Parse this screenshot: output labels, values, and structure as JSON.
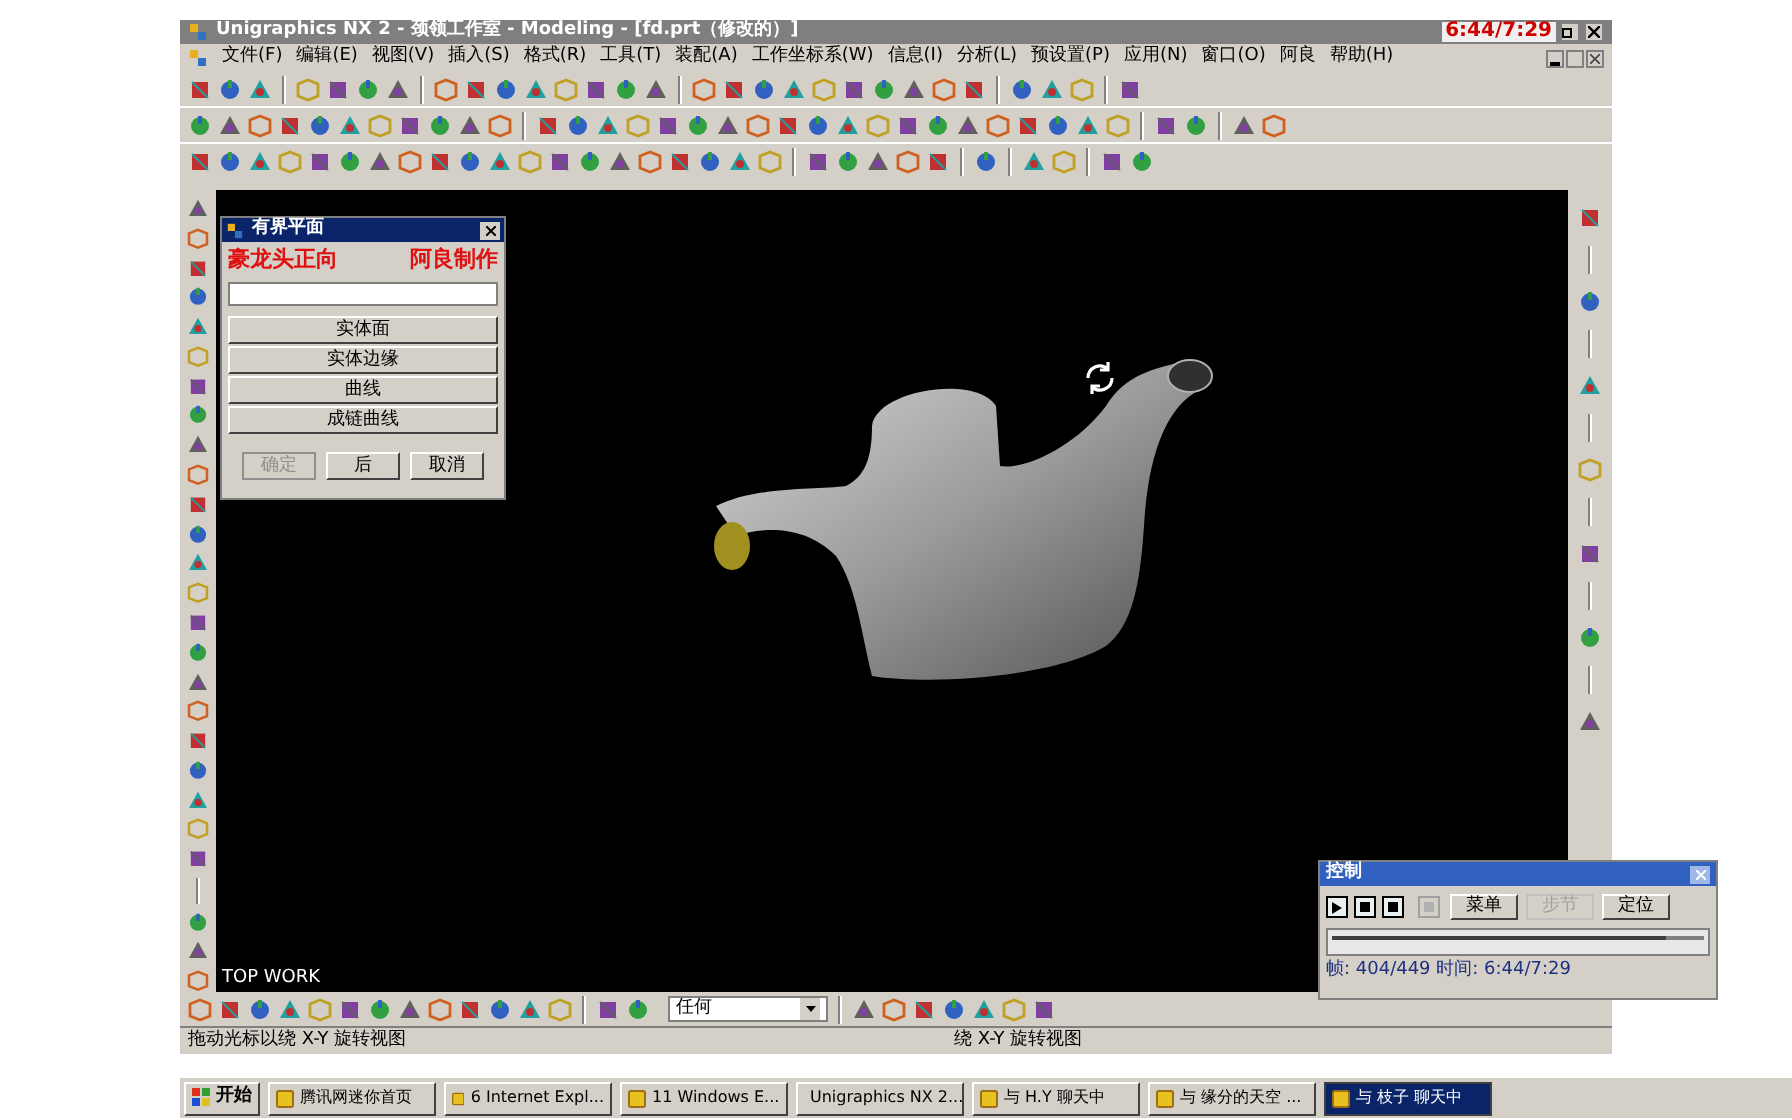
{
  "window": {
    "title": "Unigraphics NX 2 - 颈领工作室 - Modeling - [fd.prt（修改的）]"
  },
  "recording_time": "6:44/7:29",
  "menu": [
    "文件(F)",
    "编辑(E)",
    "视图(V)",
    "插入(S)",
    "格式(R)",
    "工具(T)",
    "装配(A)",
    "工作坐标系(W)",
    "信息(I)",
    "分析(L)",
    "预设置(P)",
    "应用(N)",
    "窗口(O)",
    "阿良",
    "帮助(H)"
  ],
  "dialog": {
    "title": "有界平面",
    "annotations": [
      "豪龙头正向",
      "阿良制作"
    ],
    "options": [
      "实体面",
      "实体边缘",
      "曲线",
      "成链曲线"
    ],
    "buttons": [
      {
        "label": "确定",
        "disabled": true
      },
      {
        "label": "后",
        "disabled": false
      },
      {
        "label": "取消",
        "disabled": false
      }
    ]
  },
  "viewport": {
    "view_label": "TOP WORK"
  },
  "selection_filter": {
    "value": "任何"
  },
  "status_bar": {
    "prompt": "拖动光标以绕 X-Y 旋转视图",
    "status": "绕 X-Y 旋转视图"
  },
  "control_panel": {
    "title": "控制",
    "buttons": [
      {
        "label": "菜单",
        "disabled": false
      },
      {
        "label": "步节",
        "disabled": true
      },
      {
        "label": "定位",
        "disabled": false
      }
    ],
    "playback": {
      "level": 0.9
    },
    "readout": "帧: 404/449 时间: 6:44/7:29"
  },
  "taskbar": {
    "start": "开始",
    "items": [
      {
        "label": "腾讯网迷你首页",
        "selected": false
      },
      {
        "label": "6 Internet Expl...",
        "selected": false
      },
      {
        "label": "11 Windows E...",
        "selected": false
      },
      {
        "label": "Unigraphics NX 2...",
        "selected": false
      },
      {
        "label": "与 H.Y 聊天中",
        "selected": false
      },
      {
        "label": "与 缘分的天空 ...",
        "selected": false
      },
      {
        "label": "与 枝子 聊天中",
        "selected": true
      }
    ]
  }
}
